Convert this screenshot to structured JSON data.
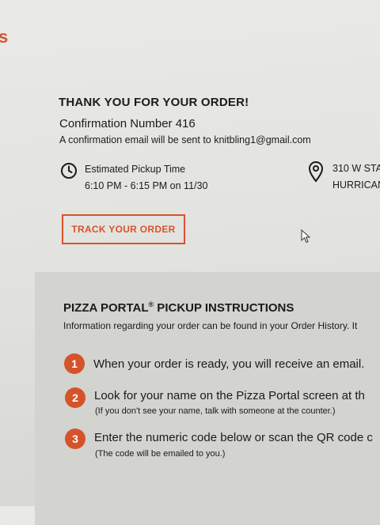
{
  "brand": {
    "fragment": "s"
  },
  "order": {
    "heading": "THANK YOU FOR YOUR ORDER!",
    "confirmation": "Confirmation Number 416",
    "email_note": "A confirmation email will be sent to knitbling1@gmail.com"
  },
  "pickup": {
    "icon": "clock-icon",
    "label": "Estimated Pickup Time",
    "time": "6:10 PM - 6:15 PM on 11/30"
  },
  "location": {
    "icon": "map-pin-icon",
    "line1": "310 W STA",
    "line2": "HURRICAN"
  },
  "track_button": "TRACK YOUR ORDER",
  "instructions": {
    "title": "PIZZA PORTAL",
    "title_mark": "®",
    "title_rest": " PICKUP INSTRUCTIONS",
    "description": "Information regarding your order can be found in your Order History. It",
    "steps": [
      {
        "number": "1",
        "text": "When your order is ready, you will receive an email.",
        "note": ""
      },
      {
        "number": "2",
        "text": "Look for your name on the Pizza Portal screen at th",
        "note": "(If you don't see your name, talk with someone at the counter.)"
      },
      {
        "number": "3",
        "text": "Enter the numeric code below or scan the QR code c",
        "note": "(The code will be emailed to you.)"
      }
    ]
  },
  "colors": {
    "accent": "#d9532b",
    "text": "#1b1b1b",
    "panel": "#d3d3cf"
  }
}
